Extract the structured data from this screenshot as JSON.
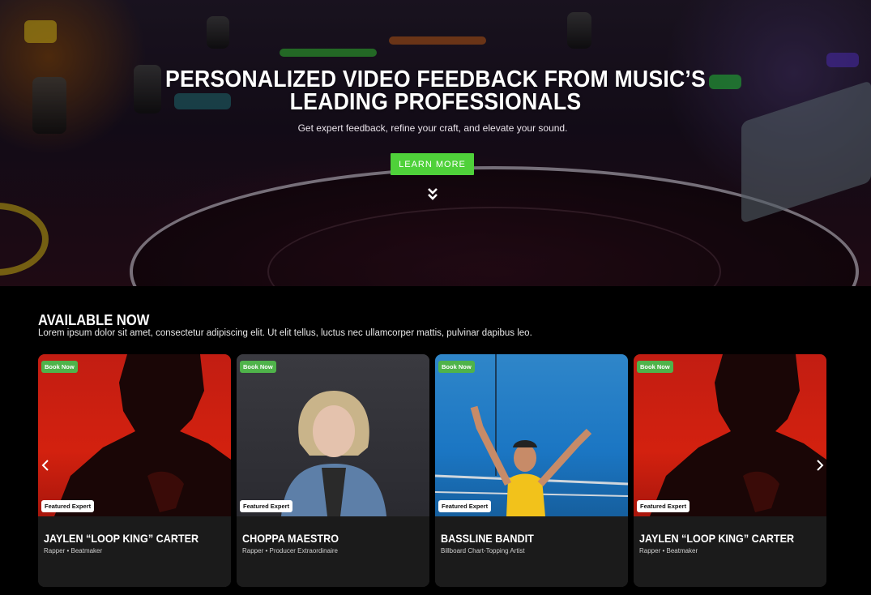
{
  "hero": {
    "title_line1": "PERSONALIZED VIDEO FEEDBACK FROM MUSIC’S",
    "title_line2": "LEADING PROFESSIONALS",
    "subtitle": "Get expert feedback, refine your craft, and elevate your sound.",
    "cta_label": "LEARN MORE",
    "cta_color": "#4fd13a"
  },
  "section": {
    "title": "AVAILABLE NOW",
    "description": "Lorem ipsum dolor sit amet, consectetur adipiscing elit. Ut elit tellus, luctus nec ullamcorper mattis, pulvinar dapibus leo."
  },
  "cards": [
    {
      "book_label": "Book Now",
      "featured_label": "Featured Expert",
      "name": "JAYLEN “LOOP KING” CARTER",
      "role": "Rapper • Beatmaker"
    },
    {
      "book_label": "Book Now",
      "featured_label": "Featured Expert",
      "name": "CHOPPA MAESTRO",
      "role": "Rapper • Producer Extraordinaire"
    },
    {
      "book_label": "Book Now",
      "featured_label": "Featured Expert",
      "name": "BASSLINE BANDIT",
      "role": "Billboard Chart-Topping Artist"
    },
    {
      "book_label": "Book Now",
      "featured_label": "Featured Expert",
      "name": "JAYLEN “LOOP KING” CARTER",
      "role": "Rapper • Beatmaker"
    }
  ],
  "carousel": {
    "prev_icon": "chevron-left-icon",
    "next_icon": "chevron-right-icon"
  },
  "colors": {
    "accent_green": "#4fd13a",
    "badge_green": "#4fb34a",
    "card_bg": "#1b1b1b"
  }
}
